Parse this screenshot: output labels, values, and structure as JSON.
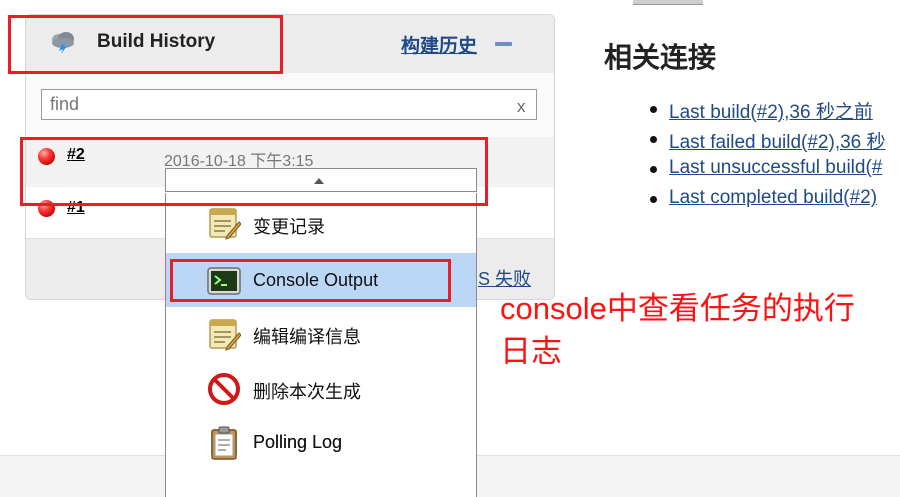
{
  "build_history": {
    "title": "Build History",
    "trend_link": "构建历史",
    "search_placeholder": "find",
    "search_clear": "x",
    "builds": [
      {
        "number": "#2",
        "date": "2016-10-18 下午3:15",
        "status": "failed"
      },
      {
        "number": "#1",
        "status": "failed"
      }
    ],
    "footer_link": "S 失败"
  },
  "context_menu": {
    "items": [
      {
        "label": "变更记录",
        "icon": "changes-notepad-icon"
      },
      {
        "label": "Console Output",
        "icon": "terminal-icon",
        "selected": true
      },
      {
        "label": "编辑编译信息",
        "icon": "edit-notepad-icon"
      },
      {
        "label": "删除本次生成",
        "icon": "no-entry-icon"
      },
      {
        "label": "Polling Log",
        "icon": "clipboard-icon"
      }
    ]
  },
  "related": {
    "title": "相关连接",
    "links": [
      "Last build(#2),36 秒之前",
      "Last failed build(#2),36 秒",
      "Last unsuccessful build(#",
      "Last completed build(#2)"
    ]
  },
  "annotation": {
    "line1": "console中查看任务的执行",
    "line2": "日志"
  },
  "colors": {
    "annotation_red": "#ee1c24",
    "link_blue": "#204a87",
    "selected_item": "#bcd7f5"
  }
}
